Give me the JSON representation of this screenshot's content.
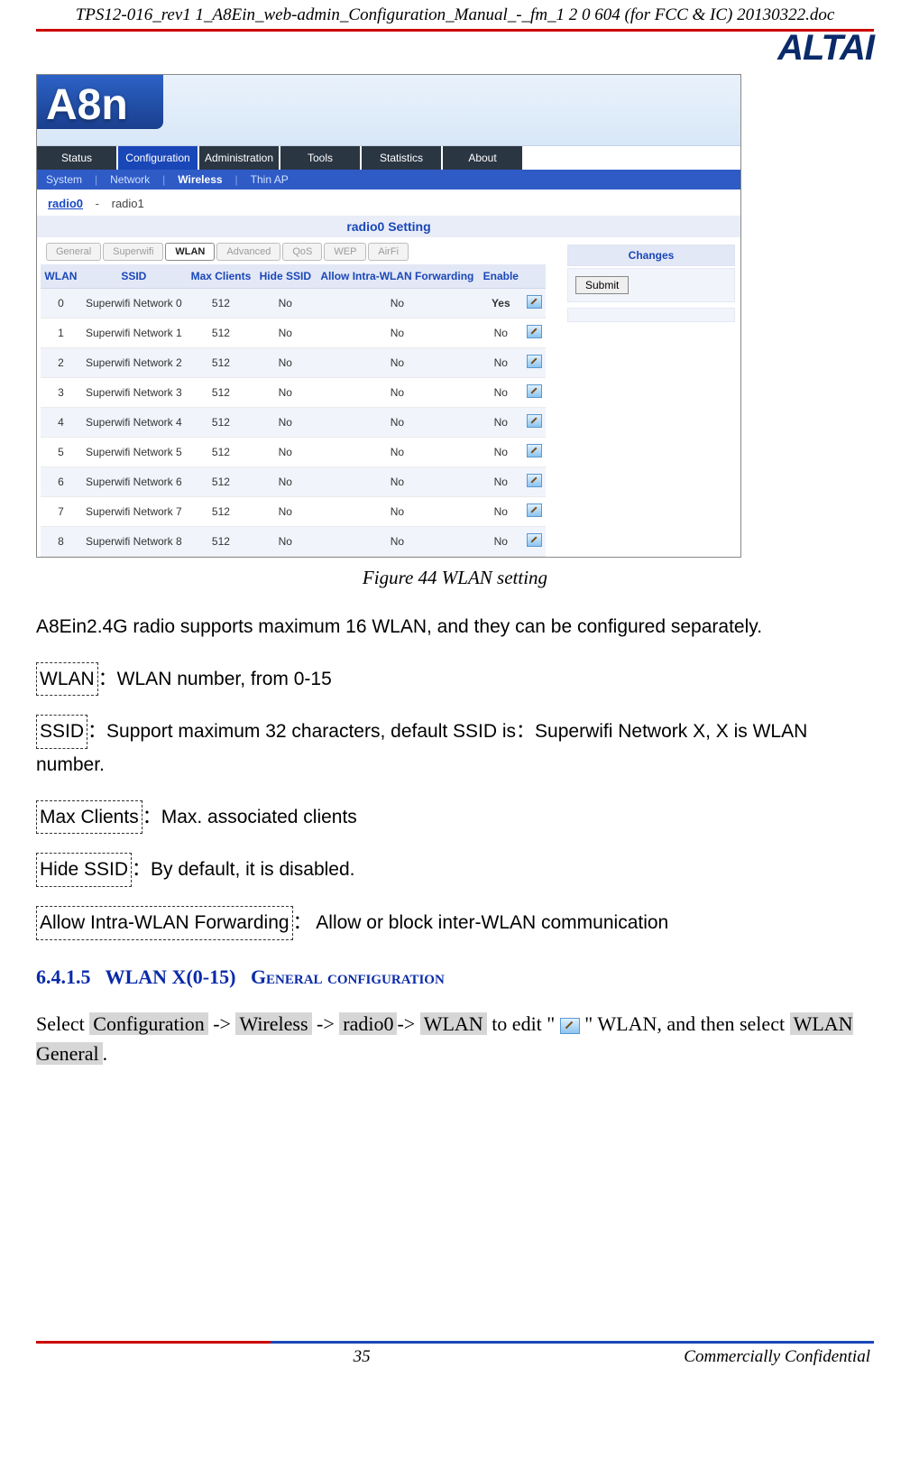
{
  "doc": {
    "header": "TPS12-016_rev1 1_A8Ein_web-admin_Configuration_Manual_-_fm_1 2 0 604 (for FCC & IC) 20130322.doc",
    "logo_main": "ALTAI",
    "page_number": "35",
    "confidential": "Commercially Confidential"
  },
  "ui": {
    "brand": "A8n",
    "nav": [
      "Status",
      "Configuration",
      "Administration",
      "Tools",
      "Statistics",
      "About"
    ],
    "nav_active_index": 1,
    "subnav": [
      "System",
      "Network",
      "Wireless",
      "Thin AP"
    ],
    "subnav_active_index": 2,
    "radio_tabs": {
      "r0": "radio0",
      "dash": "-",
      "r1": "radio1"
    },
    "section_title": "radio0 Setting",
    "pill_tabs": [
      "General",
      "Superwifi",
      "WLAN",
      "Advanced",
      "QoS",
      "WEP",
      "AirFi"
    ],
    "pill_active_index": 2,
    "table": {
      "headers": [
        "WLAN",
        "SSID",
        "Max Clients",
        "Hide SSID",
        "Allow Intra-WLAN Forwarding",
        "Enable",
        ""
      ],
      "rows": [
        {
          "wlan": "0",
          "ssid": "Superwifi Network 0",
          "max": "512",
          "hide": "No",
          "fwd": "No",
          "enable": "Yes",
          "enable_hot": true
        },
        {
          "wlan": "1",
          "ssid": "Superwifi Network 1",
          "max": "512",
          "hide": "No",
          "fwd": "No",
          "enable": "No"
        },
        {
          "wlan": "2",
          "ssid": "Superwifi Network 2",
          "max": "512",
          "hide": "No",
          "fwd": "No",
          "enable": "No"
        },
        {
          "wlan": "3",
          "ssid": "Superwifi Network 3",
          "max": "512",
          "hide": "No",
          "fwd": "No",
          "enable": "No"
        },
        {
          "wlan": "4",
          "ssid": "Superwifi Network 4",
          "max": "512",
          "hide": "No",
          "fwd": "No",
          "enable": "No"
        },
        {
          "wlan": "5",
          "ssid": "Superwifi Network 5",
          "max": "512",
          "hide": "No",
          "fwd": "No",
          "enable": "No"
        },
        {
          "wlan": "6",
          "ssid": "Superwifi Network 6",
          "max": "512",
          "hide": "No",
          "fwd": "No",
          "enable": "No"
        },
        {
          "wlan": "7",
          "ssid": "Superwifi Network 7",
          "max": "512",
          "hide": "No",
          "fwd": "No",
          "enable": "No"
        },
        {
          "wlan": "8",
          "ssid": "Superwifi Network 8",
          "max": "512",
          "hide": "No",
          "fwd": "No",
          "enable": "No"
        }
      ]
    },
    "changes_header": "Changes",
    "submit_label": "Submit"
  },
  "caption": "Figure 44 WLAN setting",
  "body": {
    "intro": "A8Ein2.4G radio supports maximum 16 WLAN, and they can be configured separately.",
    "defs": [
      {
        "term": "WLAN ",
        "desc": "：WLAN number, from 0-15"
      },
      {
        "term": "SSID",
        "desc": "：Support maximum 32 characters, default SSID is：Superwifi Network X, X is WLAN number."
      },
      {
        "term": "Max Clients",
        "desc": "：Max. associated clients"
      },
      {
        "term": "Hide SSID",
        "desc": "：By default, it is disabled."
      },
      {
        "term": "Allow Intra-WLAN Forwarding",
        "desc": "：  Allow or block inter-WLAN communication"
      }
    ]
  },
  "section": {
    "num": "6.4.1.5",
    "title_a": "WLAN X(0-15)",
    "title_b": "General configuration",
    "select_pre": "Select ",
    "path": [
      "Configuration",
      "Wireless",
      "radio0",
      "WLAN"
    ],
    "arrow": " -> ",
    "edit_pre": " to edit \" ",
    "edit_post": " \"   WLAN, and then select ",
    "path_end": "WLAN General",
    "period": "."
  }
}
